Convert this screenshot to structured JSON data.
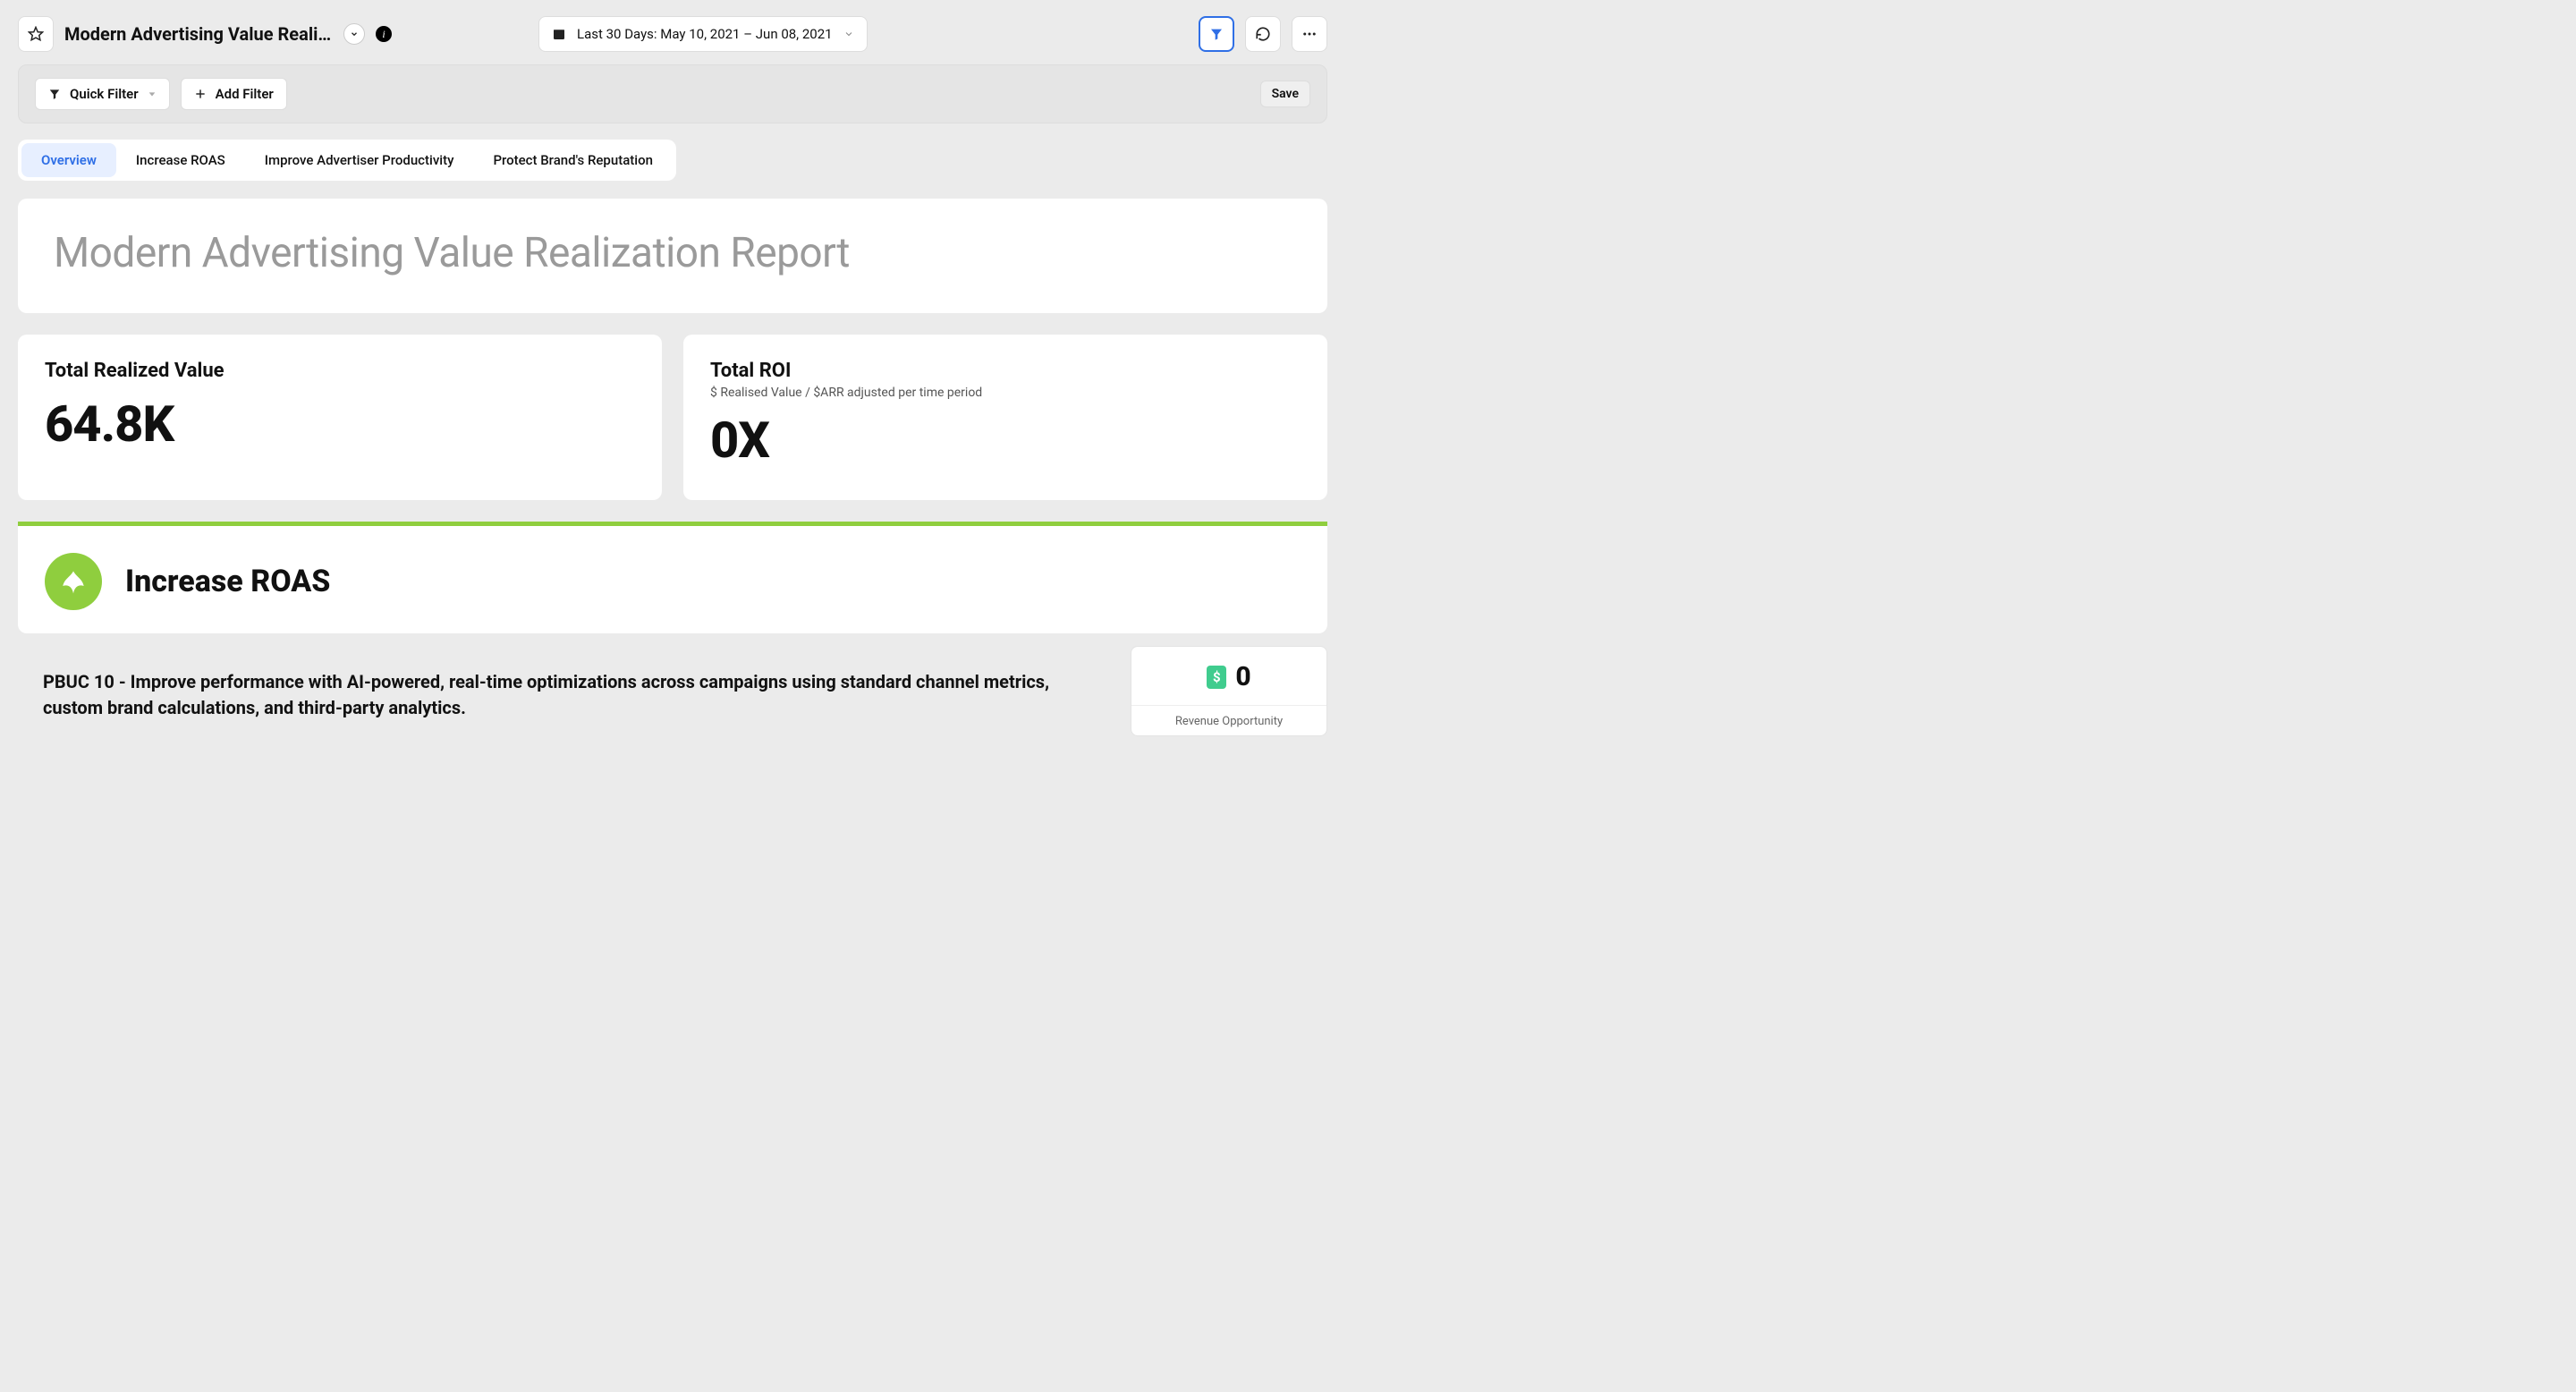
{
  "header": {
    "title": "Modern Advertising Value Realizati...",
    "date_range": "Last 30 Days: May 10, 2021 – Jun 08, 2021"
  },
  "filter_bar": {
    "quick_filter": "Quick Filter",
    "add_filter": "Add Filter",
    "save": "Save"
  },
  "tabs": [
    "Overview",
    "Increase ROAS",
    "Improve Advertiser Productivity",
    "Protect Brand's Reputation"
  ],
  "hero": {
    "title": "Modern Advertising Value Realization Report"
  },
  "stats": {
    "realized": {
      "title": "Total Realized Value",
      "value": "64.8K"
    },
    "roi": {
      "title": "Total ROI",
      "subtitle": "$ Realised Value / $ARR adjusted per time period",
      "value": "0X"
    }
  },
  "section": {
    "title": "Increase ROAS"
  },
  "detail": {
    "text": "PBUC 10 - Improve performance with AI-powered, real-time optimizations across campaigns using standard channel metrics, custom brand calculations, and third-party analytics.",
    "opportunity_value": "0",
    "opportunity_label": "Revenue Opportunity"
  }
}
